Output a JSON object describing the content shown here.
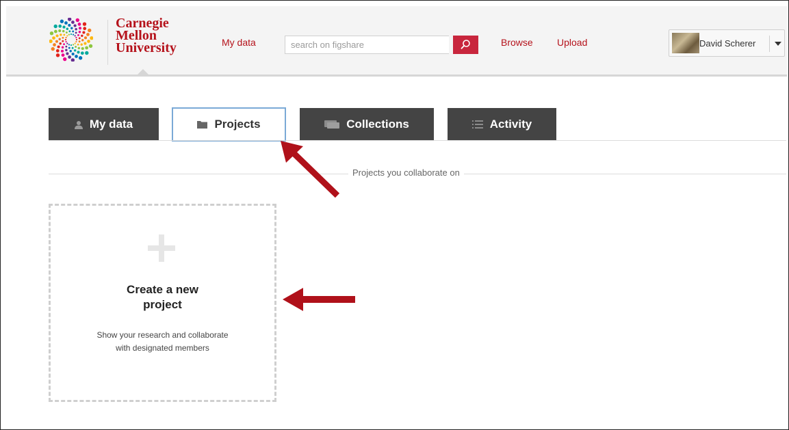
{
  "header": {
    "logo": {
      "line1": "Carnegie",
      "line2": "Mellon",
      "line3": "University"
    },
    "nav": {
      "my_data": "My data",
      "browse": "Browse",
      "upload": "Upload"
    },
    "search": {
      "placeholder": "search on figshare",
      "value": "",
      "button_icon": "search-icon"
    },
    "user": {
      "name": "David Scherer",
      "menu_icon": "caret-down-icon"
    }
  },
  "tabs": [
    {
      "label": "My data",
      "icon": "user-icon",
      "active": false
    },
    {
      "label": "Projects",
      "icon": "folder-icon",
      "active": true
    },
    {
      "label": "Collections",
      "icon": "collection-icon",
      "active": false
    },
    {
      "label": "Activity",
      "icon": "list-icon",
      "active": false
    }
  ],
  "section": {
    "label": "Projects you collaborate on"
  },
  "create_card": {
    "icon": "plus-icon",
    "title_line1": "Create a new",
    "title_line2": "project",
    "desc_line1": "Show your research and collaborate",
    "desc_line2": "with designated members"
  },
  "colors": {
    "brand_red": "#b5121b",
    "search_button": "#c8263d",
    "tab_dark": "#444444",
    "active_tab_border": "#7aa9d6",
    "annotation_arrow": "#b0111a"
  }
}
